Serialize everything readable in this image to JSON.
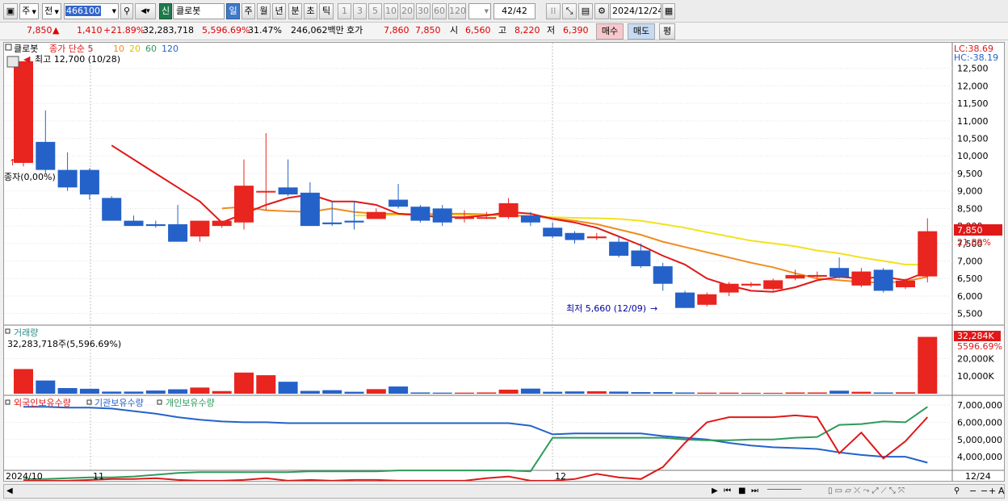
{
  "toolbar": {
    "mode": "주",
    "prev": "전",
    "code": "466100",
    "badge": "신",
    "name": "클로봇",
    "periods": [
      "일",
      "주",
      "월",
      "년",
      "분",
      "초",
      "틱"
    ],
    "intervals": [
      "1",
      "3",
      "5",
      "10",
      "20",
      "30",
      "60",
      "120"
    ],
    "count": "42",
    "count_total": "/42",
    "date": "2024/12/24"
  },
  "quote": {
    "price": "7,850",
    "arrow": "▲",
    "change": "1,410",
    "change_pct": "+21.89%",
    "volume": "32,283,718",
    "volume_pct": "5,596.69%",
    "turnover_pct": "31.47%",
    "amount": "246,062백만",
    "hoga_label": "호가",
    "ask": "7,860",
    "bid": "7,850",
    "open_label": "시",
    "open": "6,560",
    "high_label": "고",
    "high": "8,220",
    "low_label": "저",
    "low": "6,390",
    "buy": "매수",
    "sell": "매도",
    "avg": "평"
  },
  "price_panel": {
    "name": "클로봇",
    "ma_label": "종가 단순 5",
    "ma_periods": [
      "10",
      "20",
      "60",
      "120"
    ],
    "hi_note": "최고 12,700 (10/28)",
    "lo_note": "최저 5,660 (12/09)",
    "left_note": "종자(0,00%)",
    "lc": "LC:38.69",
    "hc": "HC:-38.19",
    "cur_price": "7,850",
    "cur_pct": "21.89%",
    "grid": [
      "12,500",
      "12,000",
      "11,500",
      "11,000",
      "10,500",
      "10,000",
      "9,500",
      "9,000",
      "8,500",
      "8,000",
      "7,500",
      "7,000",
      "6,500",
      "6,000",
      "5,500"
    ]
  },
  "volume_panel": {
    "title": "거래량",
    "detail": "32,283,718주(5,596.69%)",
    "cur": "32,284K",
    "cur_pct": "5596.69%",
    "ticks": [
      "20,000K",
      "10,000K"
    ]
  },
  "holdings_panel": {
    "legend": [
      "외국인보유수량",
      "기관보유수량",
      "개인보유수량"
    ],
    "ticks": [
      "7,000,000",
      "6,000,000",
      "5,000,000",
      "4,000,000"
    ]
  },
  "x_axis": {
    "labels": [
      "2024/10",
      "11",
      "12"
    ],
    "right": "12/24"
  },
  "colors": {
    "up": "#e8251f",
    "down": "#2462c9",
    "ma5": "#e01818",
    "ma10": "#f08c1e",
    "ma20": "#f2e21c",
    "foreign": "#e01818",
    "institution": "#2462c9",
    "individual": "#2e9a5a"
  },
  "chart_data": {
    "type": "candlestick",
    "candles": [
      {
        "o": 9800,
        "c": 12700,
        "h": 12700,
        "l": 9700
      },
      {
        "o": 10400,
        "c": 9600,
        "h": 11300,
        "l": 9500
      },
      {
        "o": 9600,
        "c": 9100,
        "h": 10100,
        "l": 9000
      },
      {
        "o": 9600,
        "c": 8900,
        "h": 9650,
        "l": 8750
      },
      {
        "o": 8800,
        "c": 8150,
        "h": 8850,
        "l": 8150
      },
      {
        "o": 8150,
        "c": 8000,
        "h": 8300,
        "l": 8000
      },
      {
        "o": 8050,
        "c": 8000,
        "h": 8150,
        "l": 7950
      },
      {
        "o": 8050,
        "c": 7550,
        "h": 8600,
        "l": 7550
      },
      {
        "o": 7700,
        "c": 8150,
        "h": 8150,
        "l": 7550
      },
      {
        "o": 8000,
        "c": 8150,
        "h": 8150,
        "l": 7950
      },
      {
        "o": 8100,
        "c": 9150,
        "h": 9900,
        "l": 7900
      },
      {
        "o": 9000,
        "c": 9000,
        "h": 10650,
        "l": 8450
      },
      {
        "o": 9100,
        "c": 8900,
        "h": 9900,
        "l": 8850
      },
      {
        "o": 8950,
        "c": 8000,
        "h": 9250,
        "l": 8000
      },
      {
        "o": 8100,
        "c": 8050,
        "h": 8700,
        "l": 8000
      },
      {
        "o": 8150,
        "c": 8100,
        "h": 8700,
        "l": 7900
      },
      {
        "o": 8200,
        "c": 8400,
        "h": 8500,
        "l": 8200
      },
      {
        "o": 8750,
        "c": 8550,
        "h": 9200,
        "l": 8500
      },
      {
        "o": 8550,
        "c": 8150,
        "h": 8600,
        "l": 8100
      },
      {
        "o": 8500,
        "c": 8100,
        "h": 8600,
        "l": 8000
      },
      {
        "o": 8200,
        "c": 8250,
        "h": 8450,
        "l": 8100
      },
      {
        "o": 8250,
        "c": 8250,
        "h": 8400,
        "l": 8200
      },
      {
        "o": 8250,
        "c": 8650,
        "h": 8800,
        "l": 8200
      },
      {
        "o": 8300,
        "c": 8100,
        "h": 8400,
        "l": 8000
      },
      {
        "o": 7950,
        "c": 7700,
        "h": 8100,
        "l": 7650
      },
      {
        "o": 7800,
        "c": 7600,
        "h": 7850,
        "l": 7500
      },
      {
        "o": 7650,
        "c": 7700,
        "h": 7800,
        "l": 7600
      },
      {
        "o": 7550,
        "c": 7150,
        "h": 7700,
        "l": 7100
      },
      {
        "o": 7300,
        "c": 6850,
        "h": 7500,
        "l": 6800
      },
      {
        "o": 6850,
        "c": 6350,
        "h": 6950,
        "l": 6150
      },
      {
        "o": 6100,
        "c": 5660,
        "h": 6150,
        "l": 5660
      },
      {
        "o": 5750,
        "c": 6050,
        "h": 6100,
        "l": 5700
      },
      {
        "o": 6100,
        "c": 6350,
        "h": 6400,
        "l": 6000
      },
      {
        "o": 6300,
        "c": 6350,
        "h": 6400,
        "l": 6250
      },
      {
        "o": 6200,
        "c": 6450,
        "h": 6500,
        "l": 6150
      },
      {
        "o": 6500,
        "c": 6600,
        "h": 6750,
        "l": 6450
      },
      {
        "o": 6550,
        "c": 6600,
        "h": 6700,
        "l": 6500
      },
      {
        "o": 6800,
        "c": 6550,
        "h": 7100,
        "l": 6500
      },
      {
        "o": 6300,
        "c": 6700,
        "h": 6800,
        "l": 6250
      },
      {
        "o": 6750,
        "c": 6150,
        "h": 6800,
        "l": 6100
      },
      {
        "o": 6250,
        "c": 6440,
        "h": 6500,
        "l": 6200
      },
      {
        "o": 6560,
        "c": 7850,
        "h": 8220,
        "l": 6390
      }
    ],
    "volume": [
      14000,
      7500,
      3200,
      2800,
      1200,
      1200,
      1800,
      2500,
      3500,
      1500,
      12000,
      10500,
      6800,
      1600,
      2000,
      1100,
      2600,
      4100,
      700,
      600,
      600,
      700,
      2300,
      2900,
      1100,
      1300,
      1400,
      1200,
      900,
      900,
      700,
      600,
      600,
      500,
      500,
      700,
      700,
      1700,
      1100,
      700,
      800,
      32284
    ],
    "ma5": [
      null,
      null,
      null,
      null,
      10300,
      9900,
      9500,
      9100,
      8700,
      8100,
      8350,
      8600,
      8800,
      8900,
      8700,
      8700,
      8600,
      8350,
      8300,
      8250,
      8250,
      8300,
      8400,
      8350,
      8200,
      8100,
      7950,
      7700,
      7450,
      7150,
      6900,
      6500,
      6300,
      6150,
      6120,
      6250,
      6450,
      6550,
      6500,
      6550,
      6450,
      6700
    ],
    "ma10": [
      null,
      null,
      null,
      null,
      null,
      null,
      null,
      null,
      null,
      8500,
      8550,
      8450,
      8420,
      8400,
      8500,
      8400,
      8350,
      8350,
      8330,
      8350,
      8350,
      8330,
      8300,
      8280,
      8220,
      8150,
      8050,
      7900,
      7750,
      7550,
      7400,
      7250,
      7100,
      6950,
      6820,
      6650,
      6500,
      6450,
      6400,
      6380,
      6420,
      6550
    ],
    "ma20": [
      null,
      null,
      null,
      null,
      null,
      null,
      null,
      null,
      null,
      null,
      null,
      null,
      null,
      null,
      null,
      8300,
      8300,
      8320,
      8330,
      8330,
      8320,
      8300,
      8300,
      8280,
      8250,
      8230,
      8220,
      8200,
      8150,
      8050,
      7950,
      7820,
      7700,
      7580,
      7500,
      7420,
      7300,
      7220,
      7100,
      7000,
      6900,
      6900
    ],
    "foreign": [
      2600,
      2600,
      2600,
      2650,
      2700,
      2700,
      2750,
      2650,
      2600,
      2600,
      2650,
      2750,
      2600,
      2650,
      2600,
      2650,
      2650,
      2600,
      2600,
      2600,
      2600,
      2750,
      2850,
      2600,
      2600,
      2700,
      3000,
      2800,
      2700,
      3400,
      4800,
      6000,
      6300,
      6300,
      6300,
      6400,
      6300,
      4200,
      5400,
      3900,
      4900,
      6300
    ],
    "institution": [
      6900,
      6900,
      6850,
      6850,
      6800,
      6650,
      6500,
      6300,
      6150,
      6050,
      6000,
      6000,
      5950,
      5950,
      5950,
      5950,
      5950,
      5950,
      5950,
      5950,
      5950,
      5950,
      5950,
      5800,
      5300,
      5350,
      5350,
      5350,
      5350,
      5200,
      5100,
      5000,
      4800,
      4650,
      4550,
      4500,
      4450,
      4250,
      4100,
      4000,
      4000,
      3650
    ],
    "individual": [
      2700,
      2700,
      2750,
      2800,
      2800,
      2850,
      2950,
      3050,
      3100,
      3100,
      3100,
      3100,
      3100,
      3150,
      3150,
      3150,
      3150,
      3200,
      3200,
      3200,
      3200,
      3200,
      3200,
      3150,
      5100,
      5100,
      5100,
      5100,
      5100,
      5100,
      5000,
      4950,
      4950,
      5000,
      5000,
      5100,
      5150,
      5850,
      5900,
      6050,
      6000,
      6900
    ]
  }
}
